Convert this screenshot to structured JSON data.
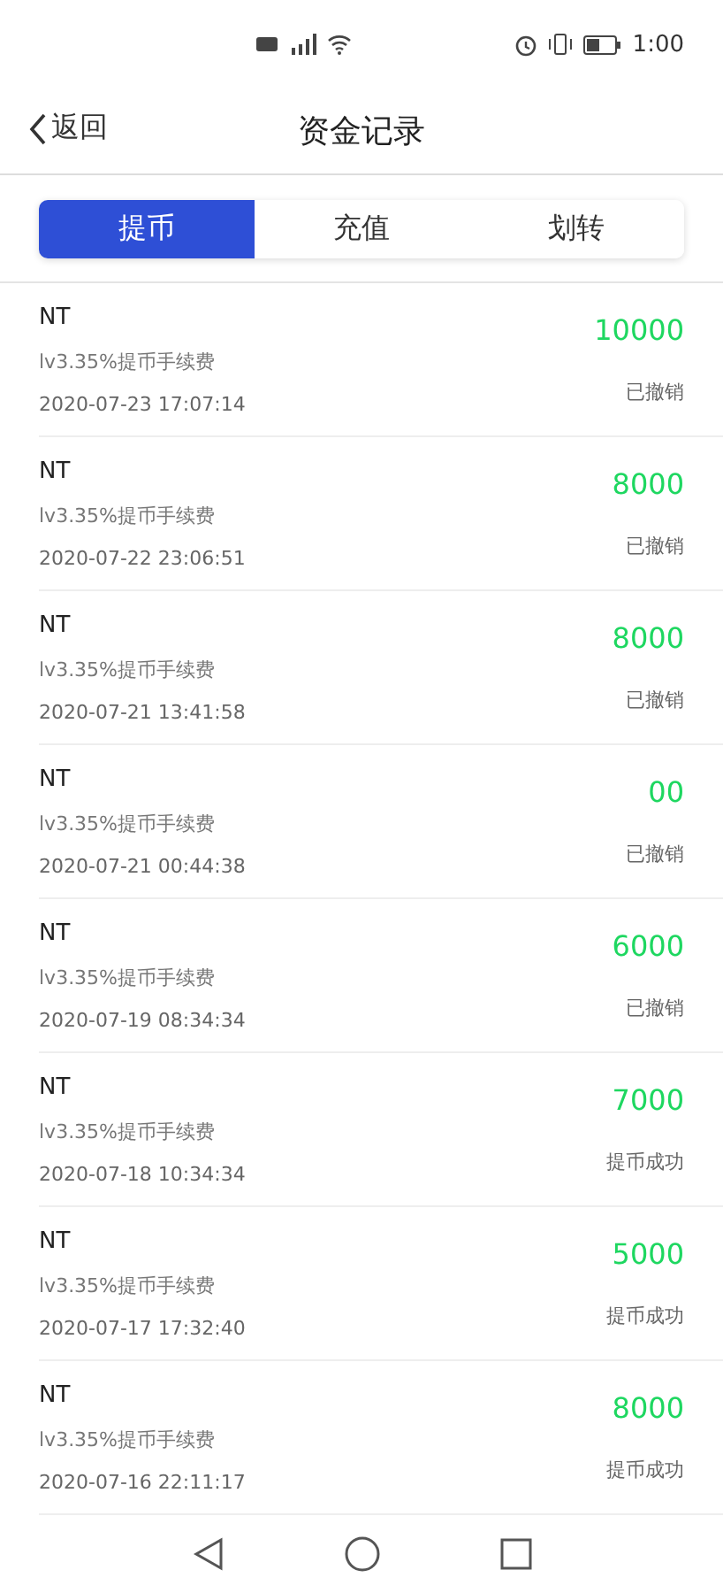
{
  "status_bar": {
    "time": "1:00"
  },
  "header": {
    "back": "返回",
    "title": "资金记录"
  },
  "tabs": [
    {
      "label": "提币",
      "selected": true
    },
    {
      "label": "充值",
      "selected": false
    },
    {
      "label": "划转",
      "selected": false
    }
  ],
  "records": [
    {
      "coin": "NT",
      "note": "lv3.35%提币手续费",
      "time": "2020-07-23 17:07:14",
      "amount": "10000",
      "status": "已撤销"
    },
    {
      "coin": "NT",
      "note": "lv3.35%提币手续费",
      "time": "2020-07-22 23:06:51",
      "amount": "8000",
      "status": "已撤销"
    },
    {
      "coin": "NT",
      "note": "lv3.35%提币手续费",
      "time": "2020-07-21 13:41:58",
      "amount": "8000",
      "status": "已撤销"
    },
    {
      "coin": "NT",
      "note": "lv3.35%提币手续费",
      "time": "2020-07-21 00:44:38",
      "amount": "00",
      "status": "已撤销"
    },
    {
      "coin": "NT",
      "note": "lv3.35%提币手续费",
      "time": "2020-07-19 08:34:34",
      "amount": "6000",
      "status": "已撤销"
    },
    {
      "coin": "NT",
      "note": "lv3.35%提币手续费",
      "time": "2020-07-18 10:34:34",
      "amount": "7000",
      "status": "提币成功"
    },
    {
      "coin": "NT",
      "note": "lv3.35%提币手续费",
      "time": "2020-07-17 17:32:40",
      "amount": "5000",
      "status": "提币成功"
    },
    {
      "coin": "NT",
      "note": "lv3.35%提币手续费",
      "time": "2020-07-16 22:11:17",
      "amount": "8000",
      "status": "提币成功"
    }
  ]
}
